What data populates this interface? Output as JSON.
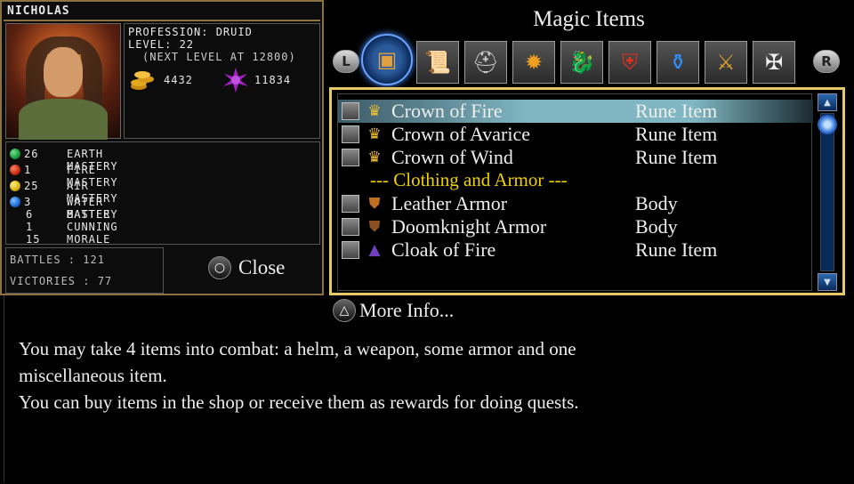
{
  "character": {
    "name": "NICHOLAS",
    "profession": "PROFESSION: DRUID",
    "level": "LEVEL: 22",
    "next_level": "(NEXT LEVEL AT 12800)",
    "gold": "4432",
    "crystals": "11834",
    "masteries": [
      {
        "value": "26",
        "label": "EARTH MASTERY",
        "orb": "#1a9a3a"
      },
      {
        "value": "1",
        "label": "FIRE MASTERY",
        "orb": "#c22a10"
      },
      {
        "value": "25",
        "label": "AIR MASTERY",
        "orb": "#d8b010"
      },
      {
        "value": "3",
        "label": "WATER MASTERY",
        "orb": "#1a6ad8"
      },
      {
        "value": "6",
        "label": "BATTLE"
      },
      {
        "value": "1",
        "label": "CUNNING"
      },
      {
        "value": "15",
        "label": "MORALE"
      }
    ],
    "battles": "BATTLES : 121",
    "victories": "VICTORIES : 77",
    "close_label": "Close"
  },
  "items_panel": {
    "title": "Magic Items",
    "l_button": "L",
    "r_button": "R",
    "tabs": [
      {
        "icon": "treasure-chest-icon",
        "glyph": "▣",
        "active": true
      },
      {
        "icon": "scroll-icon",
        "glyph": "📜"
      },
      {
        "icon": "helmet-icon",
        "glyph": "⛑"
      },
      {
        "icon": "sun-amulet-icon",
        "glyph": "✹"
      },
      {
        "icon": "dragon-icon",
        "glyph": "🐉"
      },
      {
        "icon": "shield-icon",
        "glyph": "⛨"
      },
      {
        "icon": "potion-icon",
        "glyph": "⚱"
      },
      {
        "icon": "flail-icon",
        "glyph": "⚔"
      },
      {
        "icon": "cross-icon",
        "glyph": "✠"
      }
    ],
    "rows": [
      {
        "kind": "item",
        "name": "Crown of Fire",
        "type": "Rune Item",
        "icon": "crown-icon",
        "glyph": "♛",
        "selected": true
      },
      {
        "kind": "item",
        "name": "Crown of Avarice",
        "type": "Rune Item",
        "icon": "crown-icon",
        "glyph": "♛"
      },
      {
        "kind": "item",
        "name": "Crown of Wind",
        "type": "Rune Item",
        "icon": "crown-icon",
        "glyph": "♛"
      },
      {
        "kind": "header",
        "label": "--- Clothing and Armor ---"
      },
      {
        "kind": "item",
        "name": "Leather Armor",
        "type": "Body",
        "icon": "armor-icon",
        "glyph": "⛊"
      },
      {
        "kind": "item",
        "name": "Doomknight Armor",
        "type": "Body",
        "icon": "armor-icon",
        "glyph": "⛊"
      },
      {
        "kind": "item",
        "name": "Cloak of Fire",
        "type": "Rune Item",
        "icon": "cloak-icon",
        "glyph": "▲"
      }
    ],
    "more_info_label": "More Info...",
    "more_info_button_glyph": "△",
    "close_button_glyph": "○"
  },
  "description": [
    "You may take 4 items into combat: a helm, a weapon, some armor and one",
    "miscellaneous item.",
    "You can buy items in the shop or receive them as rewards for doing quests."
  ]
}
